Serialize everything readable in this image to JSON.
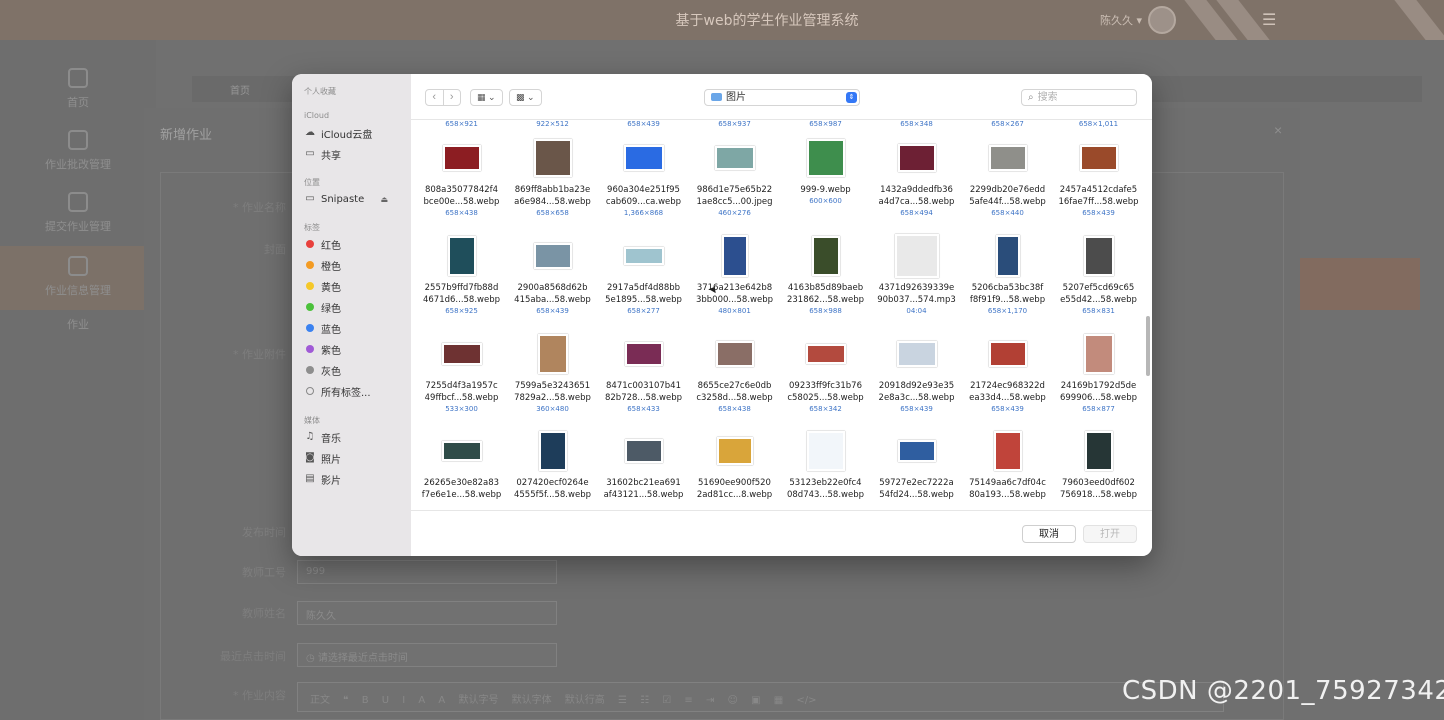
{
  "app": {
    "title": "基于web的学生作业管理系统",
    "user": "陈久久 ▾",
    "menu_icon": "hamburger-icon"
  },
  "sidebar": {
    "items": [
      {
        "label": "首页",
        "icon": "home-icon"
      },
      {
        "label": "作业批改管理",
        "icon": "chip-icon"
      },
      {
        "label": "提交作业管理",
        "icon": "chart-icon"
      },
      {
        "label": "作业信息管理",
        "icon": "grid-icon"
      },
      {
        "label": "作业",
        "icon": ""
      }
    ]
  },
  "tabs": {
    "label": "首页"
  },
  "form": {
    "title": "新增作业",
    "labels": {
      "name": "* 作业名称",
      "cover": "封面",
      "attachment": "* 作业附件",
      "publish_time": "发布时间",
      "teacher_id": "教师工号",
      "teacher_name": "教师姓名",
      "last_click": "最近点击时间",
      "content": "* 作业内容"
    },
    "values": {
      "teacher_id": "999",
      "teacher_name": "陈久久",
      "last_click_placeholder": "请选择最近点击时间"
    },
    "editor_toolbar": "正文 ❝ B U I A A 默认字号 默认字体 默认行高 ☰ ☷ ☑ ≡ ⇥ ☺ ▣ ▦ </>"
  },
  "dialog": {
    "sidebar": {
      "favorites_header": "个人收藏",
      "icloud_header": "iCloud",
      "icloud_items": [
        {
          "label": "iCloud云盘",
          "icon": "cloud-icon"
        },
        {
          "label": "共享",
          "icon": "shared-folder-icon"
        }
      ],
      "locations_header": "位置",
      "locations": [
        {
          "label": "Snipaste",
          "icon": "drive-icon",
          "eject": "⏏"
        }
      ],
      "tags_header": "标签",
      "tags": [
        {
          "label": "红色",
          "color": "#e8403c"
        },
        {
          "label": "橙色",
          "color": "#f39b23"
        },
        {
          "label": "黄色",
          "color": "#f5c829"
        },
        {
          "label": "绿色",
          "color": "#4bc13b"
        },
        {
          "label": "蓝色",
          "color": "#3b82f0"
        },
        {
          "label": "紫色",
          "color": "#a05ad6"
        },
        {
          "label": "灰色",
          "color": "#8e8e8e"
        },
        {
          "label": "所有标签...",
          "color": ""
        }
      ],
      "media_header": "媒体",
      "media": [
        {
          "label": "音乐",
          "icon": "music-icon"
        },
        {
          "label": "照片",
          "icon": "camera-icon"
        },
        {
          "label": "影片",
          "icon": "film-icon"
        }
      ]
    },
    "toolbar": {
      "folder": "图片",
      "search_placeholder": "搜索",
      "view_icon": "icon-grid-view-icon",
      "group_icon": "group-view-icon"
    },
    "top_dims": [
      "658×921",
      "922×512",
      "658×439",
      "658×937",
      "658×987",
      "658×348",
      "658×267",
      "658×1,011"
    ],
    "files": [
      {
        "line1": "808a35077842f4",
        "line2": "bce00e...58.webp",
        "dims": "658×438",
        "color": "#8c1d22",
        "w": 38,
        "h": 26
      },
      {
        "line1": "869ff8abb1ba23e",
        "line2": "a6e984...58.webp",
        "dims": "658×658",
        "color": "#6a5649",
        "w": 38,
        "h": 38
      },
      {
        "line1": "960a304e251f95",
        "line2": "cab609...ca.webp",
        "dims": "1,366×868",
        "color": "#2a6be3",
        "w": 40,
        "h": 26
      },
      {
        "line1": "986d1e75e65b22",
        "line2": "1ae8cc5...00.jpeg",
        "dims": "460×276",
        "color": "#7ea7a5",
        "w": 40,
        "h": 24
      },
      {
        "line1": "999-9.webp",
        "line2": "",
        "dims": "600×600",
        "color": "#3e8e4d",
        "w": 38,
        "h": 38
      },
      {
        "line1": "1432a9ddedfb36",
        "line2": "a4d7ca...58.webp",
        "dims": "658×494",
        "color": "#6d2034",
        "w": 38,
        "h": 28
      },
      {
        "line1": "2299db20e76edd",
        "line2": "5afe44f...58.webp",
        "dims": "658×440",
        "color": "#8f8f8a",
        "w": 38,
        "h": 26
      },
      {
        "line1": "2457a4512cdafe5",
        "line2": "16fae7ff...58.webp",
        "dims": "658×439",
        "color": "#9a4a2a",
        "w": 38,
        "h": 26
      },
      {
        "line1": "2557b9ffd7fb88d",
        "line2": "4671d6...58.webp",
        "dims": "658×925",
        "color": "#1f4e5b",
        "w": 28,
        "h": 40
      },
      {
        "line1": "2900a8568d62b",
        "line2": "415aba...58.webp",
        "dims": "658×439",
        "color": "#7a94a5",
        "w": 38,
        "h": 26
      },
      {
        "line1": "2917a5df4d88bb",
        "line2": "5e1895...58.webp",
        "dims": "658×277",
        "color": "#9fc4cf",
        "w": 40,
        "h": 18
      },
      {
        "line1": "3716a213e642b8",
        "line2": "3bb000...58.webp",
        "dims": "480×801",
        "color": "#2c4f8f",
        "w": 26,
        "h": 42
      },
      {
        "line1": "4163b85d89baeb",
        "line2": "231862...58.webp",
        "dims": "658×988",
        "color": "#3a4d2a",
        "w": 28,
        "h": 40
      },
      {
        "line1": "4371d92639339e",
        "line2": "90b037...574.mp3",
        "dims": "04:04",
        "color": "#e9e9e9",
        "w": 44,
        "h": 44
      },
      {
        "line1": "5206cba53bc38f",
        "line2": "f8f91f9...58.webp",
        "dims": "658×1,170",
        "color": "#2a4d7a",
        "w": 24,
        "h": 42
      },
      {
        "line1": "5207ef5cd69c65",
        "line2": "e55d42...58.webp",
        "dims": "658×831",
        "color": "#4c4c4c",
        "w": 30,
        "h": 40
      },
      {
        "line1": "7255d4f3a1957c",
        "line2": "49ffbcf...58.webp",
        "dims": "533×300",
        "color": "#6e3232",
        "w": 40,
        "h": 22
      },
      {
        "line1": "7599a5e3243651",
        "line2": "7829a2...58.webp",
        "dims": "360×480",
        "color": "#b0855e",
        "w": 30,
        "h": 40
      },
      {
        "line1": "8471c003107b41",
        "line2": "82b728...58.webp",
        "dims": "658×433",
        "color": "#7a2c55",
        "w": 38,
        "h": 24
      },
      {
        "line1": "8655ce27c6e0db",
        "line2": "c3258d...58.webp",
        "dims": "658×438",
        "color": "#8a6e66",
        "w": 38,
        "h": 26
      },
      {
        "line1": "09233ff9fc31b76",
        "line2": "c58025...58.webp",
        "dims": "658×342",
        "color": "#b34a3e",
        "w": 40,
        "h": 20
      },
      {
        "line1": "20918d92e93e35",
        "line2": "2e8a3c...58.webp",
        "dims": "658×439",
        "color": "#c9d4e0",
        "w": 40,
        "h": 26
      },
      {
        "line1": "21724ec968322d",
        "line2": "ea33d4...58.webp",
        "dims": "658×439",
        "color": "#b24034",
        "w": 38,
        "h": 26
      },
      {
        "line1": "24169b1792d5de",
        "line2": "699906...58.webp",
        "dims": "658×877",
        "color": "#c28b7c",
        "w": 30,
        "h": 40
      },
      {
        "line1": "26265e30e82a83",
        "line2": "f7e6e1e...58.webp",
        "dims": "",
        "color": "#2f4c48",
        "w": 40,
        "h": 20
      },
      {
        "line1": "027420ecf0264e",
        "line2": "4555f5f...58.webp",
        "dims": "",
        "color": "#1e3d5a",
        "w": 28,
        "h": 40
      },
      {
        "line1": "31602bc21ea691",
        "line2": "af43121...58.webp",
        "dims": "",
        "color": "#4d5a66",
        "w": 38,
        "h": 24
      },
      {
        "line1": "51690ee900f520",
        "line2": "2ad81cc...8.webp",
        "dims": "",
        "color": "#d9a53a",
        "w": 36,
        "h": 28
      },
      {
        "line1": "53123eb22e0fc4",
        "line2": "08d743...58.webp",
        "dims": "",
        "color": "#f2f6fa",
        "w": 38,
        "h": 40
      },
      {
        "line1": "59727e2ec7222a",
        "line2": "54fd24...58.webp",
        "dims": "",
        "color": "#2f5ea0",
        "w": 38,
        "h": 22
      },
      {
        "line1": "75149aa6c7df04c",
        "line2": "80a193...58.webp",
        "dims": "",
        "color": "#c0443a",
        "w": 28,
        "h": 40
      },
      {
        "line1": "79603eed0df602",
        "line2": "756918...58.webp",
        "dims": "",
        "color": "#263636",
        "w": 28,
        "h": 40
      }
    ],
    "buttons": {
      "cancel": "取消",
      "open": "打开"
    }
  },
  "watermark": "CSDN @2201_75927342"
}
